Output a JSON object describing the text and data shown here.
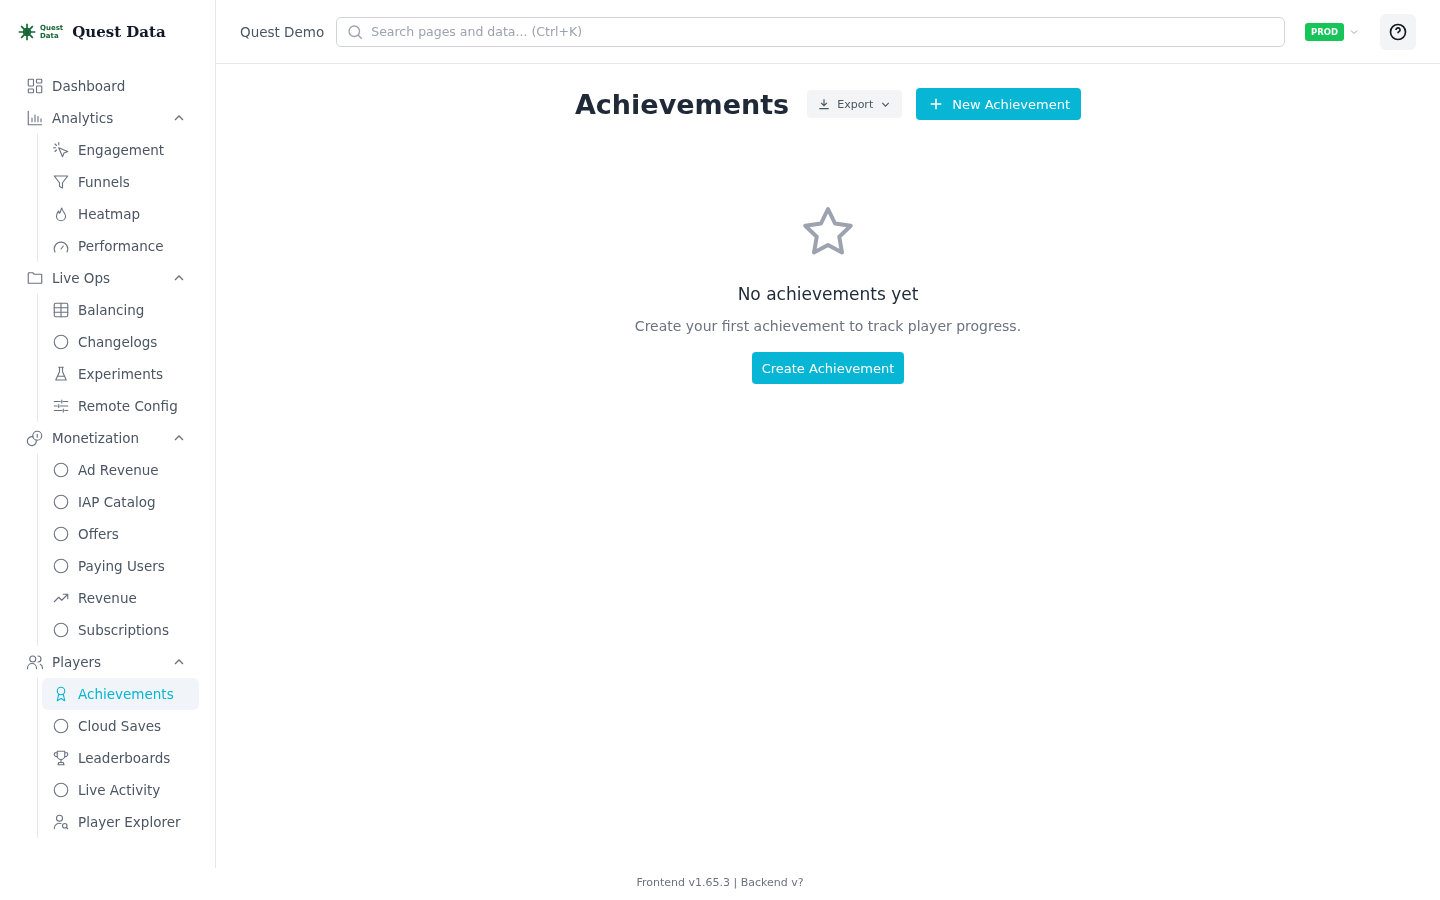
{
  "logo": {
    "mark_text_top": "Quest",
    "mark_text_bottom": "Data",
    "name": "Quest Data"
  },
  "sidebar": {
    "items": [
      {
        "kind": "link",
        "label": "Dashboard",
        "selected": false
      },
      {
        "kind": "group",
        "label": "Analytics",
        "expanded": true,
        "children": [
          {
            "label": "Engagement",
            "selected": false
          },
          {
            "label": "Funnels",
            "selected": false
          },
          {
            "label": "Heatmap",
            "selected": false
          },
          {
            "label": "Performance",
            "selected": false
          }
        ]
      },
      {
        "kind": "group",
        "label": "Live Ops",
        "expanded": true,
        "children": [
          {
            "label": "Balancing",
            "selected": false
          },
          {
            "label": "Changelogs",
            "selected": false
          },
          {
            "label": "Experiments",
            "selected": false
          },
          {
            "label": "Remote Config",
            "selected": false
          }
        ]
      },
      {
        "kind": "group",
        "label": "Monetization",
        "expanded": true,
        "children": [
          {
            "label": "Ad Revenue",
            "selected": false
          },
          {
            "label": "IAP Catalog",
            "selected": false
          },
          {
            "label": "Offers",
            "selected": false
          },
          {
            "label": "Paying Users",
            "selected": false
          },
          {
            "label": "Revenue",
            "selected": false
          },
          {
            "label": "Subscriptions",
            "selected": false
          }
        ]
      },
      {
        "kind": "group",
        "label": "Players",
        "expanded": true,
        "children": [
          {
            "label": "Achievements",
            "selected": true
          },
          {
            "label": "Cloud Saves",
            "selected": false
          },
          {
            "label": "Leaderboards",
            "selected": false
          },
          {
            "label": "Live Activity",
            "selected": false
          },
          {
            "label": "Player Explorer",
            "selected": false
          }
        ]
      }
    ]
  },
  "header": {
    "project": "Quest Demo",
    "search": {
      "placeholder": "Search pages and data... (Ctrl+K)"
    },
    "environment": "PROD"
  },
  "page": {
    "title": "Achievements",
    "export_button": "Export",
    "new_button": "New Achievement"
  },
  "empty_state": {
    "title": "No achievements yet",
    "message": "Create your first achievement to track player progress.",
    "button": "Create Achievement"
  },
  "footer": "Frontend v1.65.3 | Backend v?"
}
